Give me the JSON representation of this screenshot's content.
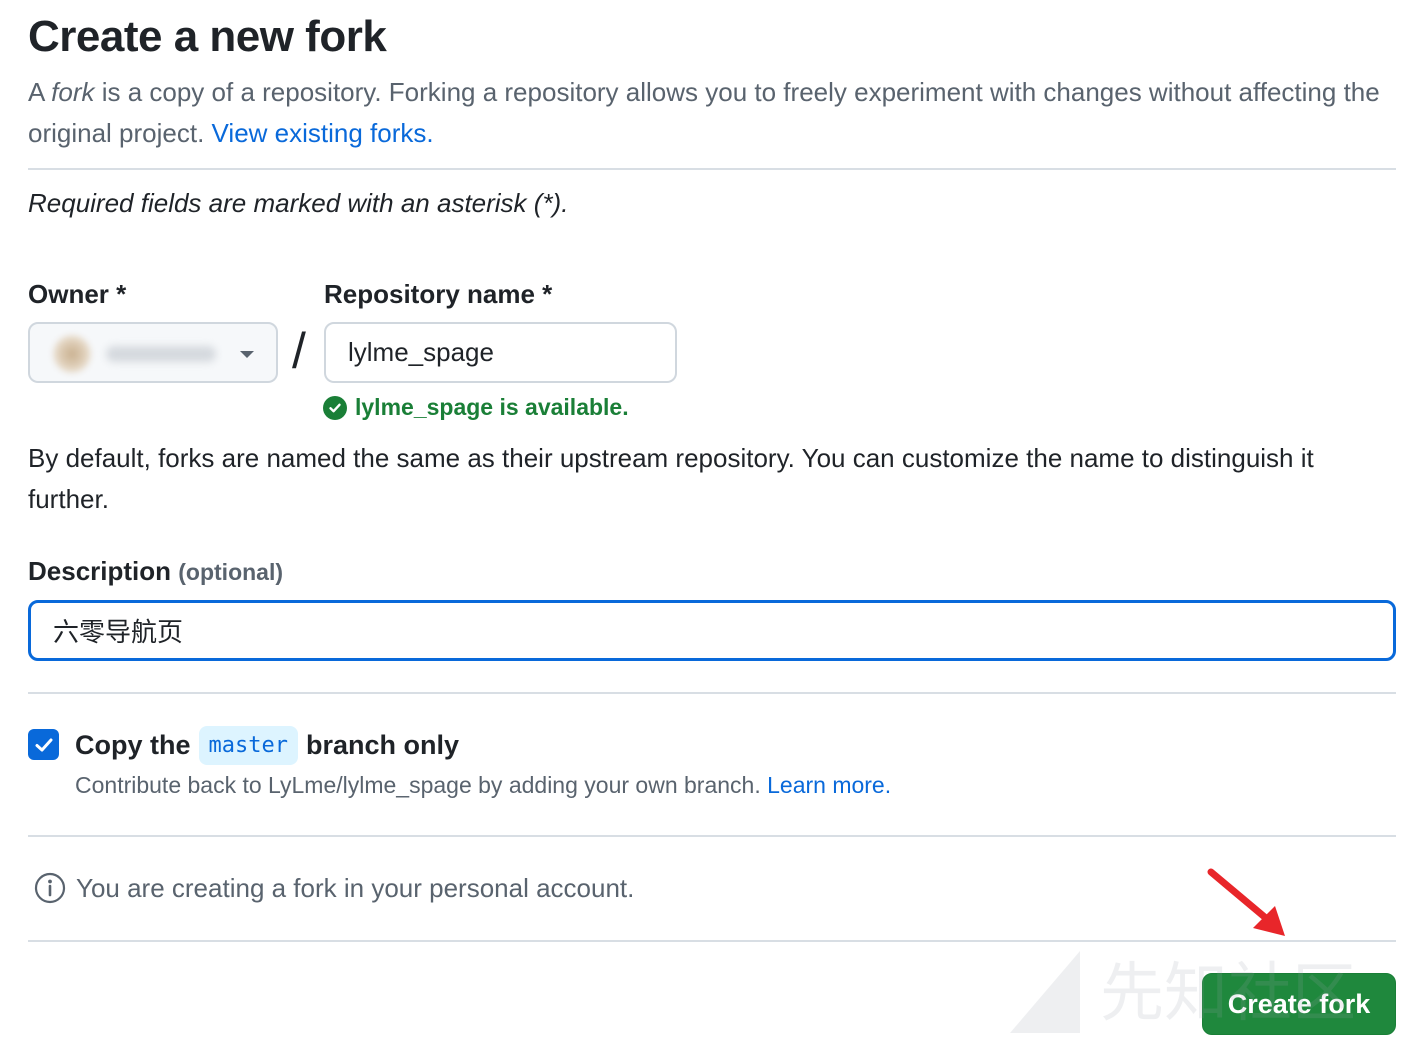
{
  "header": {
    "title": "Create a new fork",
    "intro_prefix": "A ",
    "intro_fork_word": "fork",
    "intro_rest": " is a copy of a repository. Forking a repository allows you to freely experiment with changes without affecting the original project. ",
    "view_forks_link": "View existing forks."
  },
  "form": {
    "required_note": "Required fields are marked with an asterisk (*).",
    "owner_label": "Owner *",
    "repo_label": "Repository name *",
    "slash": "/",
    "repo_value": "lylme_spage",
    "availability": "lylme_spage is available.",
    "default_note": "By default, forks are named the same as their upstream repository. You can customize the name to distinguish it further.",
    "description_label": "Description",
    "description_optional": "(optional)",
    "description_value": "六零导航页"
  },
  "copy_branch": {
    "checked": true,
    "label_prefix": "Copy the",
    "branch": "master",
    "label_suffix": "branch only",
    "sub_text": "Contribute back to LyLme/lylme_spage by adding your own branch. ",
    "learn_more": "Learn more."
  },
  "info": {
    "text": "You are creating a fork in your personal account."
  },
  "actions": {
    "create_fork": "Create fork"
  },
  "watermark": {
    "text": "先知社区"
  },
  "colors": {
    "link": "#0969da",
    "success": "#1a7f37",
    "primary_button": "#1f883d",
    "annotation_arrow": "#e8262a"
  }
}
